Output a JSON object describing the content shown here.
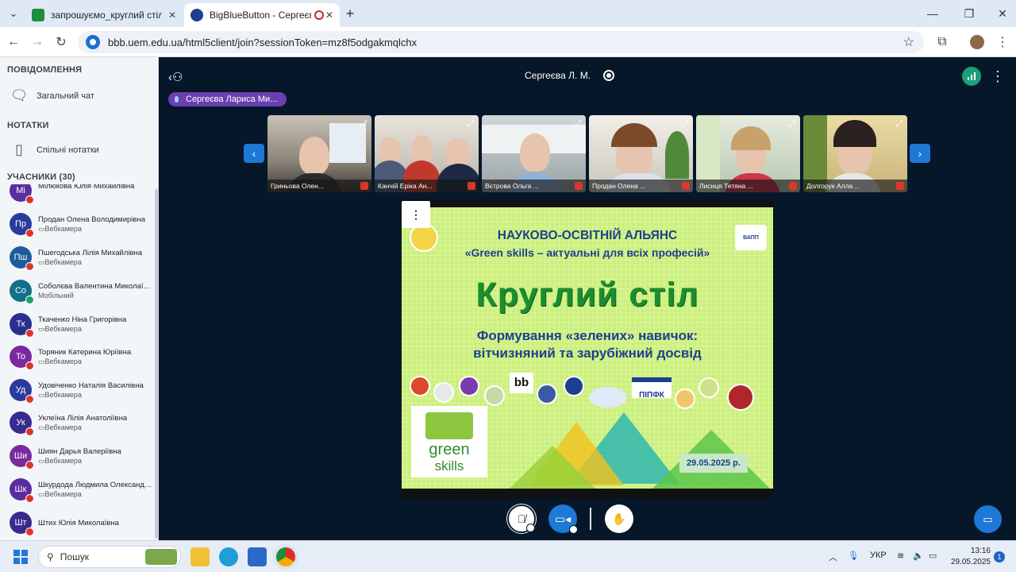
{
  "browser": {
    "tabs": [
      {
        "title": "запрошуємо_круглий стіл • all/"
      },
      {
        "title": "BigBlueButton - Сергеєва Л"
      }
    ],
    "new_tab": "+",
    "url": "bbb.uem.edu.ua/html5client/join?sessionToken=mz8f5odgakmqlchx"
  },
  "sidebar": {
    "messages_title": "ПОВІДОМЛЕННЯ",
    "public_chat": "Загальний чат",
    "notes_title": "НОТАТКИ",
    "shared_notes": "Спільні нотатки",
    "participants_title": "УЧАСНИКИ (30)",
    "participants": [
      {
        "initials": "Мі",
        "name": "Мілюкова Юлія Михайлівна",
        "status": "",
        "color": "#5b2d9e",
        "mic": "muted"
      },
      {
        "initials": "Пр",
        "name": "Продан Олена Володимирівна",
        "status": "▭Вебкамера",
        "color": "#2b3b9c",
        "mic": "muted"
      },
      {
        "initials": "Пш",
        "name": "Пшегодська Лілія Михайлівна",
        "status": "▭Вебкамера",
        "color": "#1f5c9c",
        "mic": "muted"
      },
      {
        "initials": "Со",
        "name": "Соболєва Валентина Миколаївна",
        "status": "Мобільний",
        "color": "#14708a",
        "mic": "listen"
      },
      {
        "initials": "Тк",
        "name": "Ткаченко Ніна Григорівна",
        "status": "▭Вебкамера",
        "color": "#2a2f8f",
        "mic": "muted"
      },
      {
        "initials": "То",
        "name": "Торяник Катерина Юріївна",
        "status": "▭Вебкамера",
        "color": "#7a2a9e",
        "mic": "muted"
      },
      {
        "initials": "Уд",
        "name": "Удовіченко Наталія Василівна",
        "status": "▭Вебкамера",
        "color": "#2b3b9c",
        "mic": "muted"
      },
      {
        "initials": "Ук",
        "name": "Уклеїна Лілія Анатоліївна",
        "status": "▭Вебкамера",
        "color": "#3a2a8f",
        "mic": "muted"
      },
      {
        "initials": "Ши",
        "name": "Шиян Дарья Валеріївна",
        "status": "▭Вебкамера",
        "color": "#7a2a9e",
        "mic": "muted"
      },
      {
        "initials": "Шк",
        "name": "Шкурдода Людмила Олександрі...",
        "status": "▭Вебкамера",
        "color": "#5b2d9e",
        "mic": "muted"
      },
      {
        "initials": "Шт",
        "name": "Штих Юлія Миколаївна",
        "status": "",
        "color": "#3a2a8f",
        "mic": "muted"
      }
    ]
  },
  "meeting": {
    "presenter": "Сергеєва Л. М.",
    "talking": "Сергеєва Лариса Ми...",
    "videos": [
      {
        "name": "Гриньова Олен..."
      },
      {
        "name": "Канчій Еріка Ан..."
      },
      {
        "name": "Вєтрова Ольга ..."
      },
      {
        "name": "Продан Олена ..."
      },
      {
        "name": "Лисиця Тетяна ..."
      },
      {
        "name": "Долгорук Алла ..."
      }
    ],
    "slide_menu": "⋮"
  },
  "slide": {
    "line1": "НАУКОВО-ОСВІТНІЙ АЛЬЯНС",
    "line2": "«Green skills – актуальні для всіх професій»",
    "title": "Круглий стіл",
    "subtitle1": "Формування «зелених» навичок:",
    "subtitle2": "вітчизняний та зарубіжний досвід",
    "date": "29.05.2025 р.",
    "badge": "ВАПП",
    "logo_text": "ПІПФК",
    "green": "green",
    "skills": "skills"
  },
  "taskbar": {
    "search": "Пошук",
    "lang": "УКР",
    "time": "13:16",
    "date": "29.05.2025",
    "notifications": "1"
  }
}
